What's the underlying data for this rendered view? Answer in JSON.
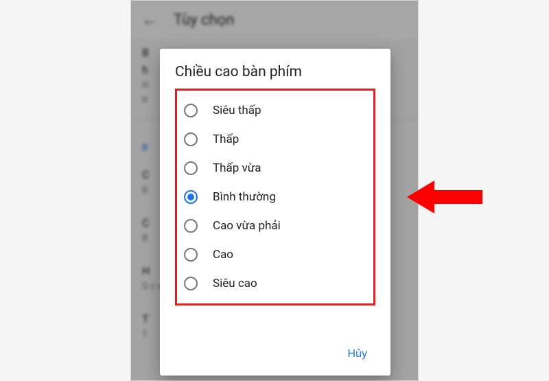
{
  "background": {
    "header_title": "Tùy chọn",
    "items": [
      {
        "title": "B",
        "sub": "h"
      },
      {
        "title": "H",
        "sub": "tr"
      }
    ],
    "section_label": "B",
    "more": [
      {
        "title": "C",
        "sub": "Đ"
      },
      {
        "title": "C",
        "sub": "B"
      },
      {
        "title": "H",
        "sub": "G c x"
      },
      {
        "title": "T",
        "sub": "T"
      }
    ]
  },
  "dialog": {
    "title": "Chiều cao bàn phím",
    "options": [
      {
        "label": "Siêu thấp",
        "selected": false
      },
      {
        "label": "Thấp",
        "selected": false
      },
      {
        "label": "Thấp vừa",
        "selected": false
      },
      {
        "label": "Bình thường",
        "selected": true
      },
      {
        "label": "Cao vừa phải",
        "selected": false
      },
      {
        "label": "Cao",
        "selected": false
      },
      {
        "label": "Siêu cao",
        "selected": false
      }
    ],
    "cancel_label": "Hủy"
  },
  "annotation": {
    "arrow": "red-arrow-left"
  }
}
